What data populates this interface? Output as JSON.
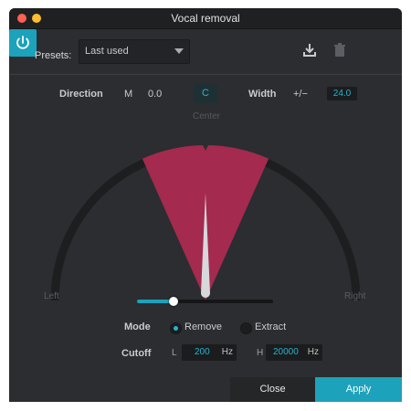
{
  "window": {
    "title": "Vocal removal"
  },
  "presets": {
    "label": "Presets:",
    "selected": "Last used"
  },
  "toolbar": {
    "icons": [
      "download-icon",
      "trash-icon",
      "power-icon"
    ],
    "power_on": true
  },
  "direction": {
    "label": "Direction",
    "mode": "M",
    "value": "0.0",
    "center_button": "C",
    "center_label": "Center"
  },
  "width": {
    "label": "Width",
    "symbol": "+/−",
    "value": "24.0"
  },
  "dial": {
    "left_label": "Left",
    "right_label": "Right",
    "direction_value": 0.0,
    "width_degrees": 24.0
  },
  "slider": {
    "fraction": 0.27
  },
  "mode": {
    "label": "Mode",
    "options": [
      {
        "label": "Remove",
        "selected": true
      },
      {
        "label": "Extract",
        "selected": false
      }
    ]
  },
  "cutoff": {
    "label": "Cutoff",
    "low_prefix": "L",
    "low_value": "200",
    "low_unit": "Hz",
    "high_prefix": "H",
    "high_value": "20000",
    "high_unit": "Hz"
  },
  "footer": {
    "close_label": "Close",
    "apply_label": "Apply"
  },
  "colors": {
    "accent": "#1da2bb",
    "sector": "#a42a4f",
    "panel": "#2b2d30"
  }
}
